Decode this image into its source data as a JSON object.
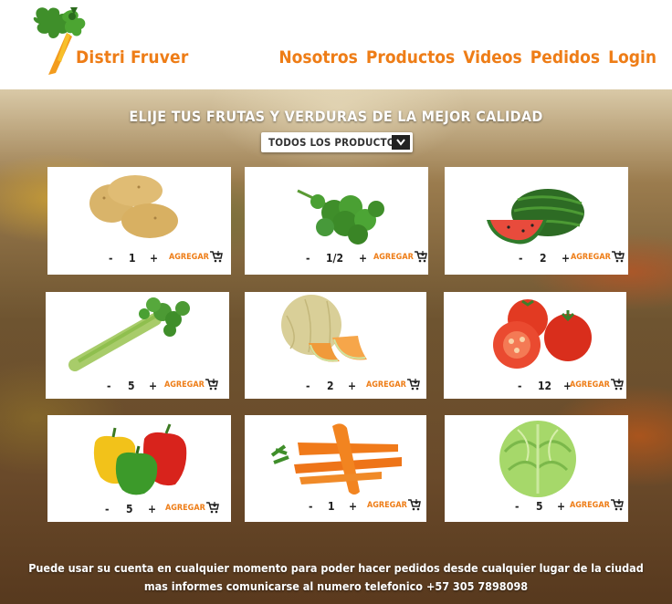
{
  "brand": {
    "name": "Distri Fruver"
  },
  "nav": [
    "Nosotros",
    "Productos",
    "Videos",
    "Pedidos",
    "Login"
  ],
  "headline": "ELIJE TUS FRUTAS Y VERDURAS DE LA MEJOR CALIDAD",
  "filter": {
    "label": "TODOS LOS PRODUCTOS"
  },
  "products": [
    {
      "icon": "potato-image",
      "quantity": "1"
    },
    {
      "icon": "cilantro-image",
      "quantity": "1/2"
    },
    {
      "icon": "watermelon-image",
      "quantity": "2"
    },
    {
      "icon": "celery-image",
      "quantity": "5"
    },
    {
      "icon": "melon-image",
      "quantity": "2"
    },
    {
      "icon": "tomato-image",
      "quantity": "12"
    },
    {
      "icon": "bell-pepper-image",
      "quantity": "5"
    },
    {
      "icon": "carrot-image",
      "quantity": "1"
    },
    {
      "icon": "lettuce-image",
      "quantity": "5"
    }
  ],
  "controls": {
    "minus": "-",
    "plus": "+",
    "add": "AGREGAR"
  },
  "footer": {
    "line1": "Puede usar su cuenta en cualquier momento para poder hacer pedidos desde cualquier lugar de la ciudad",
    "line2": "mas informes comunicarse al numero telefonico +57 305 7898098"
  },
  "colors": {
    "accent": "#ee7d17",
    "text": "#222222"
  }
}
